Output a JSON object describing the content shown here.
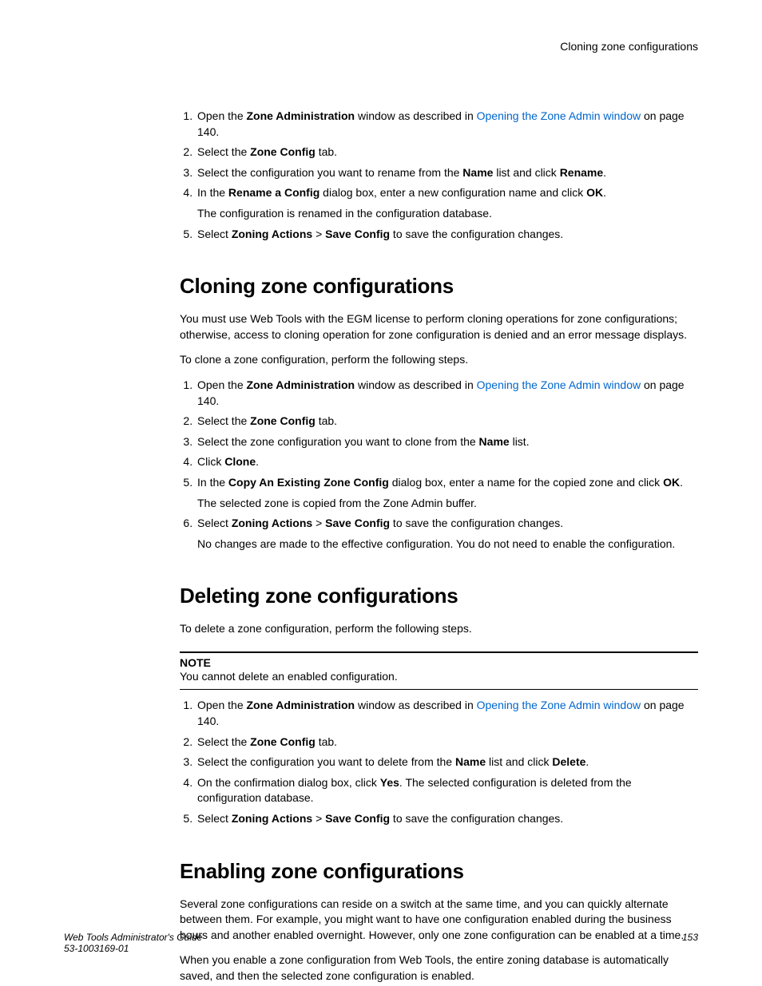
{
  "header": {
    "right": "Cloning zone configurations"
  },
  "intro_list": {
    "i1": {
      "pre": "Open the ",
      "b1": "Zone Administration",
      "mid": " window as described in ",
      "link": "Opening the Zone Admin window",
      "post": " on page 140."
    },
    "i2": {
      "pre": "Select the ",
      "b1": "Zone Config",
      "post": " tab."
    },
    "i3": {
      "pre": "Select the configuration you want to rename from the ",
      "b1": "Name",
      "mid": " list and click ",
      "b2": "Rename",
      "post": "."
    },
    "i4": {
      "pre": "In the ",
      "b1": "Rename a Config",
      "mid": " dialog box, enter a new configuration name and click ",
      "b2": "OK",
      "post": ".",
      "sub": "The configuration is renamed in the configuration database."
    },
    "i5": {
      "pre": "Select ",
      "b1": "Zoning Actions ",
      "mid": " > ",
      "b2": "Save Config",
      "post": " to save the configuration changes."
    }
  },
  "sec1": {
    "title": "Cloning zone configurations",
    "p1": "You must use Web Tools with the EGM license to perform cloning operations for zone configurations; otherwise, access to cloning operation for zone configuration is denied and an error message displays.",
    "p2": "To clone a zone configuration, perform the following steps.",
    "i1": {
      "pre": "Open the ",
      "b1": "Zone Administration",
      "mid": " window as described in ",
      "link": "Opening the Zone Admin window",
      "post": " on page 140."
    },
    "i2": {
      "pre": "Select the ",
      "b1": "Zone Config",
      "post": " tab."
    },
    "i3": {
      "pre": "Select the zone configuration you want to clone from the ",
      "b1": "Name",
      "post": " list."
    },
    "i4": {
      "pre": "Click ",
      "b1": "Clone",
      "post": "."
    },
    "i5": {
      "pre": "In the ",
      "b1": "Copy An Existing Zone Config",
      "mid": " dialog box, enter a name for the copied zone and click ",
      "b2": "OK",
      "post": ".",
      "sub": "The selected zone is copied from the Zone Admin buffer."
    },
    "i6": {
      "pre": "Select ",
      "b1": "Zoning Actions ",
      "mid": " > ",
      "b2": "Save Config",
      "post": " to save the configuration changes.",
      "sub": "No changes are made to the effective configuration. You do not need to enable the configuration."
    }
  },
  "sec2": {
    "title": "Deleting zone configurations",
    "p1": "To delete a zone configuration, perform the following steps.",
    "note_title": "NOTE",
    "note_text": "You cannot delete an enabled configuration.",
    "i1": {
      "pre": "Open the ",
      "b1": "Zone Administration",
      "mid": " window as described in ",
      "link": "Opening the Zone Admin window",
      "post": " on page 140."
    },
    "i2": {
      "pre": "Select the ",
      "b1": "Zone Config",
      "post": " tab."
    },
    "i3": {
      "pre": "Select the configuration you want to delete from the ",
      "b1": "Name",
      "mid": " list and click ",
      "b2": "Delete",
      "post": "."
    },
    "i4": {
      "pre": "On the confirmation dialog box, click ",
      "b1": "Yes",
      "post": ". The selected configuration is deleted from the configuration database."
    },
    "i5": {
      "pre": "Select ",
      "b1": "Zoning Actions ",
      "mid": " > ",
      "b2": "Save Config",
      "post": " to save the configuration changes."
    }
  },
  "sec3": {
    "title": "Enabling zone configurations",
    "p1": "Several zone configurations can reside on a switch at the same time, and you can quickly alternate between them. For example, you might want to have one configuration enabled during the business hours and another enabled overnight. However, only one zone configuration can be enabled at a time.",
    "p2": "When you enable a zone configuration from Web Tools, the entire zoning database is automatically saved, and then the selected zone configuration is enabled."
  },
  "footer": {
    "left1": "Web Tools Administrator's Guide",
    "left2": "53-1003169-01",
    "right": "153"
  }
}
